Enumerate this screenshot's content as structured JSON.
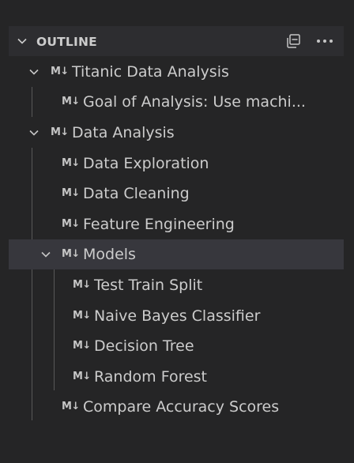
{
  "outline": {
    "title": "OUTLINE",
    "collapse_all_icon": "collapse-all-icon",
    "more_actions_icon": "ellipsis-icon",
    "md_badge": "M↓",
    "items": [
      {
        "label": "Titanic Data Analysis",
        "level": 0,
        "expanded": true
      },
      {
        "label": "Goal of Analysis: Use machi...",
        "level": 1
      },
      {
        "label": "Data Analysis",
        "level": 0,
        "expanded": true
      },
      {
        "label": "Data Exploration",
        "level": 1
      },
      {
        "label": "Data Cleaning",
        "level": 1
      },
      {
        "label": "Feature Engineering",
        "level": 1
      },
      {
        "label": "Models",
        "level": 1,
        "expanded": true,
        "selected": true
      },
      {
        "label": "Test Train Split",
        "level": 2
      },
      {
        "label": "Naive Bayes Classifier",
        "level": 2
      },
      {
        "label": "Decision Tree",
        "level": 2
      },
      {
        "label": "Random Forest",
        "level": 2
      },
      {
        "label": "Compare Accuracy Scores",
        "level": 1
      }
    ]
  }
}
